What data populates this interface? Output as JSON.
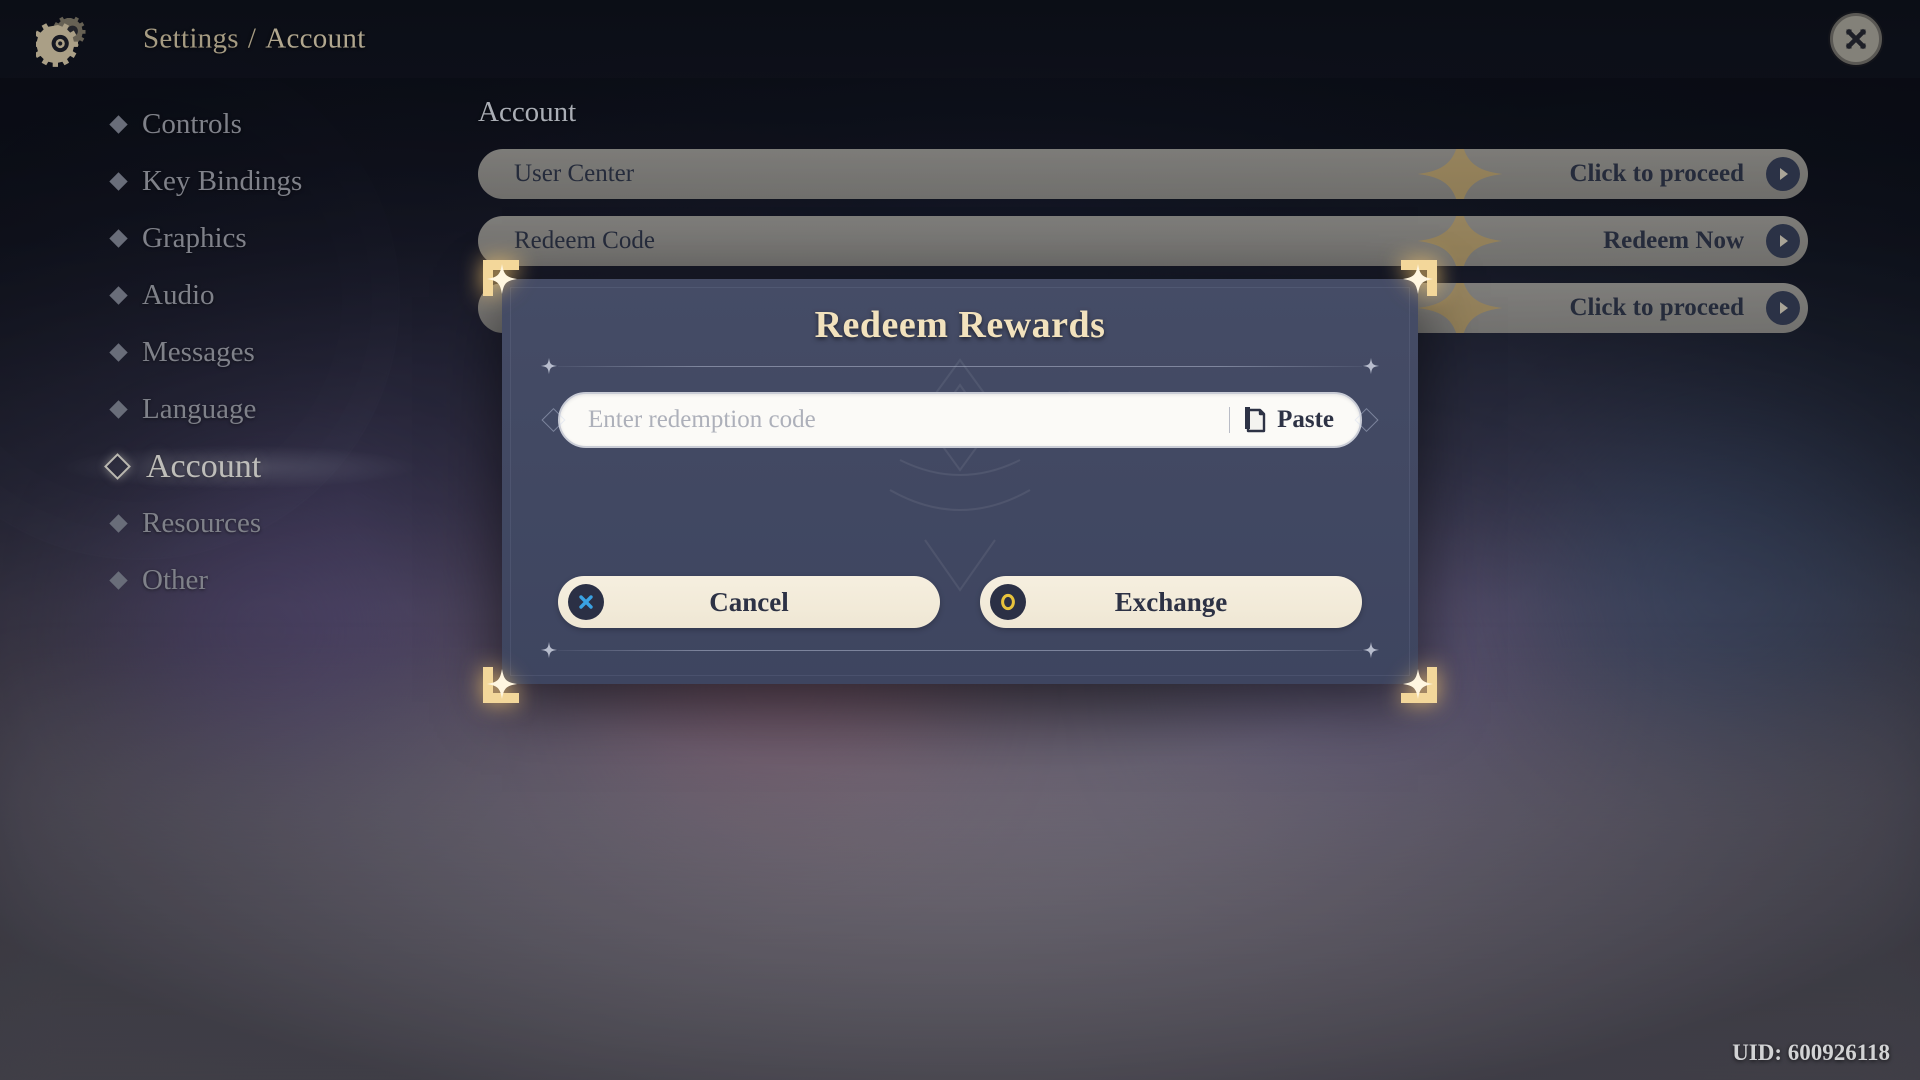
{
  "header": {
    "gear_icon": "gear-icon",
    "breadcrumb_root": "Settings",
    "breadcrumb_sep": "/",
    "breadcrumb_current": "Account",
    "close_icon": "close-icon"
  },
  "sidebar": {
    "items": [
      {
        "label": "Controls",
        "active": false
      },
      {
        "label": "Key Bindings",
        "active": false
      },
      {
        "label": "Graphics",
        "active": false
      },
      {
        "label": "Audio",
        "active": false
      },
      {
        "label": "Messages",
        "active": false
      },
      {
        "label": "Language",
        "active": false
      },
      {
        "label": "Account",
        "active": true
      },
      {
        "label": "Resources",
        "active": false
      },
      {
        "label": "Other",
        "active": false
      }
    ]
  },
  "main": {
    "section_title": "Account",
    "rows": [
      {
        "label": "User Center",
        "action": "Click to proceed",
        "arrow_icon": "chevron-right-icon"
      },
      {
        "label": "Redeem Code",
        "action": "Redeem Now",
        "arrow_icon": "chevron-right-icon"
      },
      {
        "label": "",
        "action": "Click to proceed",
        "arrow_icon": "chevron-right-icon"
      }
    ]
  },
  "modal": {
    "title": "Redeem Rewards",
    "input": {
      "value": "",
      "placeholder": "Enter redemption code",
      "paste_label": "Paste",
      "paste_icon": "clipboard-icon"
    },
    "cancel": {
      "label": "Cancel",
      "icon": "cross-icon"
    },
    "confirm": {
      "label": "Exchange",
      "icon": "circle-ring-icon"
    }
  },
  "footer": {
    "uid": "UID: 600926118"
  },
  "colors": {
    "gold": "#f2e2bd",
    "modal_bg": "#434a63",
    "row_bg": "#b3afa4",
    "button_bg": "#f3ecd9",
    "cancel_accent": "#3aa3e3",
    "confirm_accent": "#e8c33c",
    "text_dark": "#2d3245",
    "nav_text": "#9a9ba4",
    "nav_active_text": "#e9e6dd"
  }
}
